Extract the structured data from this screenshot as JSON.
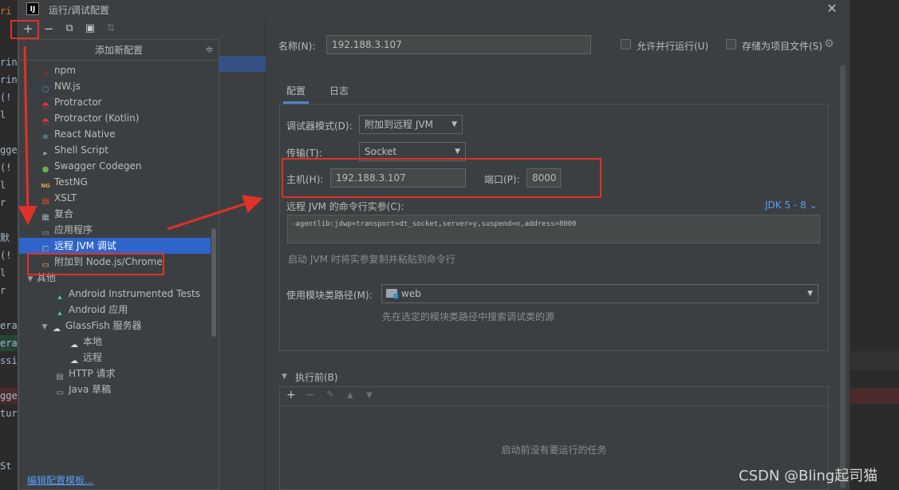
{
  "window": {
    "title": "运行/调试配置",
    "close": "✕",
    "logo": "IJ"
  },
  "editor_fragments": [
    "ri",
    "rin",
    "rin",
    "(!",
    "l",
    "gge",
    "(!",
    "l",
    "r",
    "默",
    "(!",
    "l",
    "r",
    "era",
    "era",
    "ssi",
    "gge",
    "tur",
    "St"
  ],
  "toolbar": {
    "add": "+",
    "remove": "−",
    "copy": "⧉",
    "folder": "▣",
    "sort": "⇅"
  },
  "popup": {
    "title": "添加新配置",
    "pin": "≑",
    "items": [
      {
        "label": "npm",
        "icon": "npm-icon",
        "color": "#c12127",
        "glyph": "n"
      },
      {
        "label": "NW.js",
        "icon": "nwjs-icon",
        "color": "#4a90d9",
        "glyph": "⬡"
      },
      {
        "label": "Protractor",
        "icon": "protractor-icon",
        "color": "#e23237",
        "glyph": "◓"
      },
      {
        "label": "Protractor (Kotlin)",
        "icon": "protractor-kotlin-icon",
        "color": "#e23237",
        "glyph": "◓"
      },
      {
        "label": "React Native",
        "icon": "react-icon",
        "color": "#61dafb",
        "glyph": "⚛"
      },
      {
        "label": "Shell Script",
        "icon": "shell-script-icon",
        "color": "#9aa7b0",
        "glyph": "▸"
      },
      {
        "label": "Swagger Codegen",
        "icon": "swagger-icon",
        "color": "#6ab04c",
        "glyph": "●"
      },
      {
        "label": "TestNG",
        "icon": "testng-icon",
        "color": "#e8a33d",
        "glyph": "NG"
      },
      {
        "label": "XSLT",
        "icon": "xslt-icon",
        "color": "#e34c26",
        "glyph": "▤"
      },
      {
        "label": "复合",
        "icon": "compound-icon",
        "color": "#9aa7b0",
        "glyph": "▦"
      },
      {
        "label": "应用程序",
        "icon": "application-icon",
        "color": "#9aa7b0",
        "glyph": "▭"
      },
      {
        "label": "远程 JVM 调试",
        "icon": "remote-jvm-icon",
        "color": "#9aa7b0",
        "glyph": "⧠",
        "selected": true
      },
      {
        "label": "附加到 Node.js/Chrome",
        "icon": "nodejs-icon",
        "color": "#e8a33d",
        "glyph": "▭"
      }
    ],
    "other_group": {
      "label": "其他",
      "arrow": "▼"
    },
    "other_items": [
      {
        "label": "Android Instrumented Tests",
        "icon": "android-icon",
        "color": "#3ddc84",
        "glyph": "▴"
      },
      {
        "label": "Android 应用",
        "icon": "android-icon",
        "color": "#3ddc84",
        "glyph": "▴"
      }
    ],
    "glassfish": {
      "label": "GlassFish 服务器",
      "arrow": "▼",
      "children": [
        "本地",
        "远程"
      ]
    },
    "http": {
      "label": "HTTP 请求",
      "icon": "api-icon"
    },
    "more": {
      "label": "Java 草稿"
    },
    "footer": "编辑配置模板..."
  },
  "form": {
    "name_label": "名称(N):",
    "name_value": "192.188.3.107",
    "allow_parallel": "允许并行运行(U)",
    "store_as_project": "存储为项目文件(S)",
    "tabs": [
      "配置",
      "日志"
    ],
    "debugger_mode_label": "调试器模式(D):",
    "debugger_mode_value": "附加到远程 JVM",
    "transport_label": "传输(T):",
    "transport_value": "Socket",
    "host_label": "主机(H):",
    "host_value": "192.188.3.107",
    "port_label": "端口(P):",
    "port_value": "8000",
    "cmd_label": "远程 JVM 的命令行实参(C):",
    "jdk_link": "JDK 5 - 8 ⌄",
    "cmd_value": "-agentlib:jdwp=transport=dt_socket,server=y,suspend=n,address=8000",
    "cmd_hint": "启动 JVM 时将实参复制并粘贴到命令行",
    "module_label": "使用模块类路径(M):",
    "module_value": "web",
    "module_hint": "先在选定的模块类路径中搜索调试类的源",
    "before_launch": "执行前(B)",
    "before_empty": "启动前没有要运行的任务"
  },
  "watermark": "CSDN @Bling起司猫",
  "colors": {
    "highlight_red": "#e0312a",
    "selection": "#2f65ca",
    "link": "#589df6"
  }
}
